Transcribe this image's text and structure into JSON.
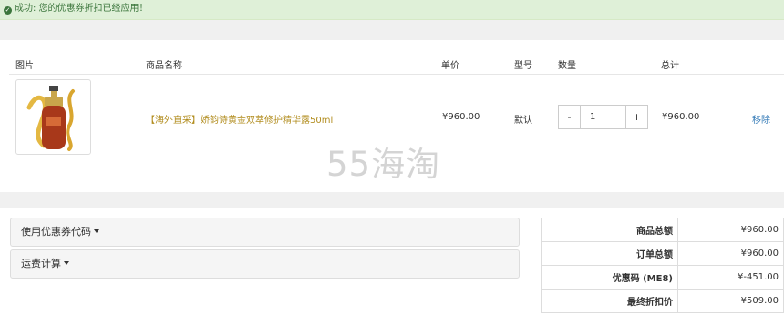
{
  "alert": {
    "icon": "check-circle-icon",
    "text": "成功: 您的优惠券折扣已经应用！"
  },
  "cart": {
    "headers": {
      "image": "图片",
      "name": "商品名称",
      "unit_price": "单价",
      "model": "型号",
      "quantity": "数量",
      "total": "总计"
    },
    "item": {
      "name": "【海外直采】娇韵诗黄金双萃修护精华露50ml",
      "unit_price": "¥960.00",
      "model": "默认",
      "quantity": "1",
      "total": "¥960.00",
      "remove": "移除",
      "minus": "-",
      "plus": "+"
    }
  },
  "watermark": "55海淘",
  "panels": {
    "coupon": "使用优惠券代码",
    "shipping": "运费计算"
  },
  "totals": [
    {
      "label": "商品总额",
      "value": "¥960.00"
    },
    {
      "label": "订单总额",
      "value": "¥960.00"
    },
    {
      "label": "优惠码 (ME8)",
      "value": "¥-451.00"
    },
    {
      "label": "最终折扣价",
      "value": "¥509.00"
    }
  ]
}
